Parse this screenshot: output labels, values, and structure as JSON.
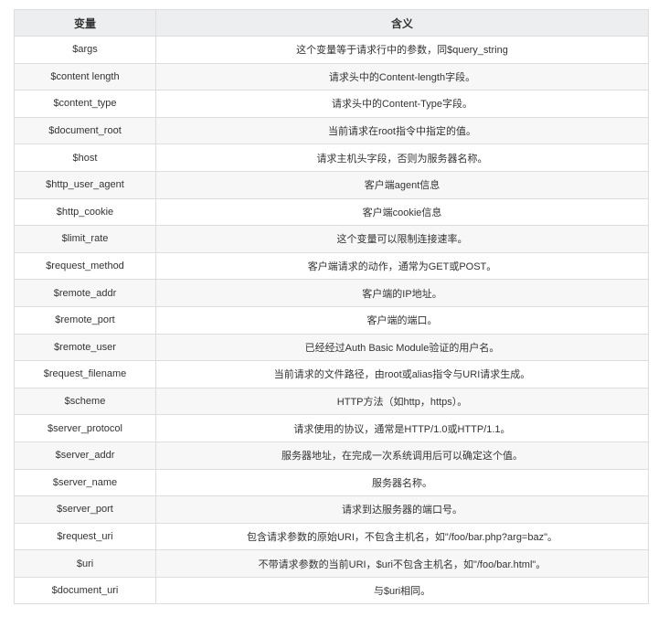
{
  "table": {
    "headers": [
      "变量",
      "含义"
    ],
    "rows": [
      [
        "$args",
        "这个变量等于请求行中的参数，同$query_string"
      ],
      [
        "$content length",
        "请求头中的Content-length字段。"
      ],
      [
        "$content_type",
        "请求头中的Content-Type字段。"
      ],
      [
        "$document_root",
        "当前请求在root指令中指定的值。"
      ],
      [
        "$host",
        "请求主机头字段，否则为服务器名称。"
      ],
      [
        "$http_user_agent",
        "客户端agent信息"
      ],
      [
        "$http_cookie",
        "客户端cookie信息"
      ],
      [
        "$limit_rate",
        "这个变量可以限制连接速率。"
      ],
      [
        "$request_method",
        "客户端请求的动作，通常为GET或POST。"
      ],
      [
        "$remote_addr",
        "客户端的IP地址。"
      ],
      [
        "$remote_port",
        "客户端的端口。"
      ],
      [
        "$remote_user",
        "已经经过Auth Basic Module验证的用户名。"
      ],
      [
        "$request_filename",
        "当前请求的文件路径，由root或alias指令与URI请求生成。"
      ],
      [
        "$scheme",
        "HTTP方法（如http，https）。"
      ],
      [
        "$server_protocol",
        "请求使用的协议，通常是HTTP/1.0或HTTP/1.1。"
      ],
      [
        "$server_addr",
        "服务器地址，在完成一次系统调用后可以确定这个值。"
      ],
      [
        "$server_name",
        "服务器名称。"
      ],
      [
        "$server_port",
        "请求到达服务器的端口号。"
      ],
      [
        "$request_uri",
        "包含请求参数的原始URI，不包含主机名，如\"/foo/bar.php?arg=baz\"。"
      ],
      [
        "$uri",
        "不带请求参数的当前URI，$uri不包含主机名，如\"/foo/bar.html\"。"
      ],
      [
        "$document_uri",
        "与$uri相同。"
      ]
    ]
  }
}
